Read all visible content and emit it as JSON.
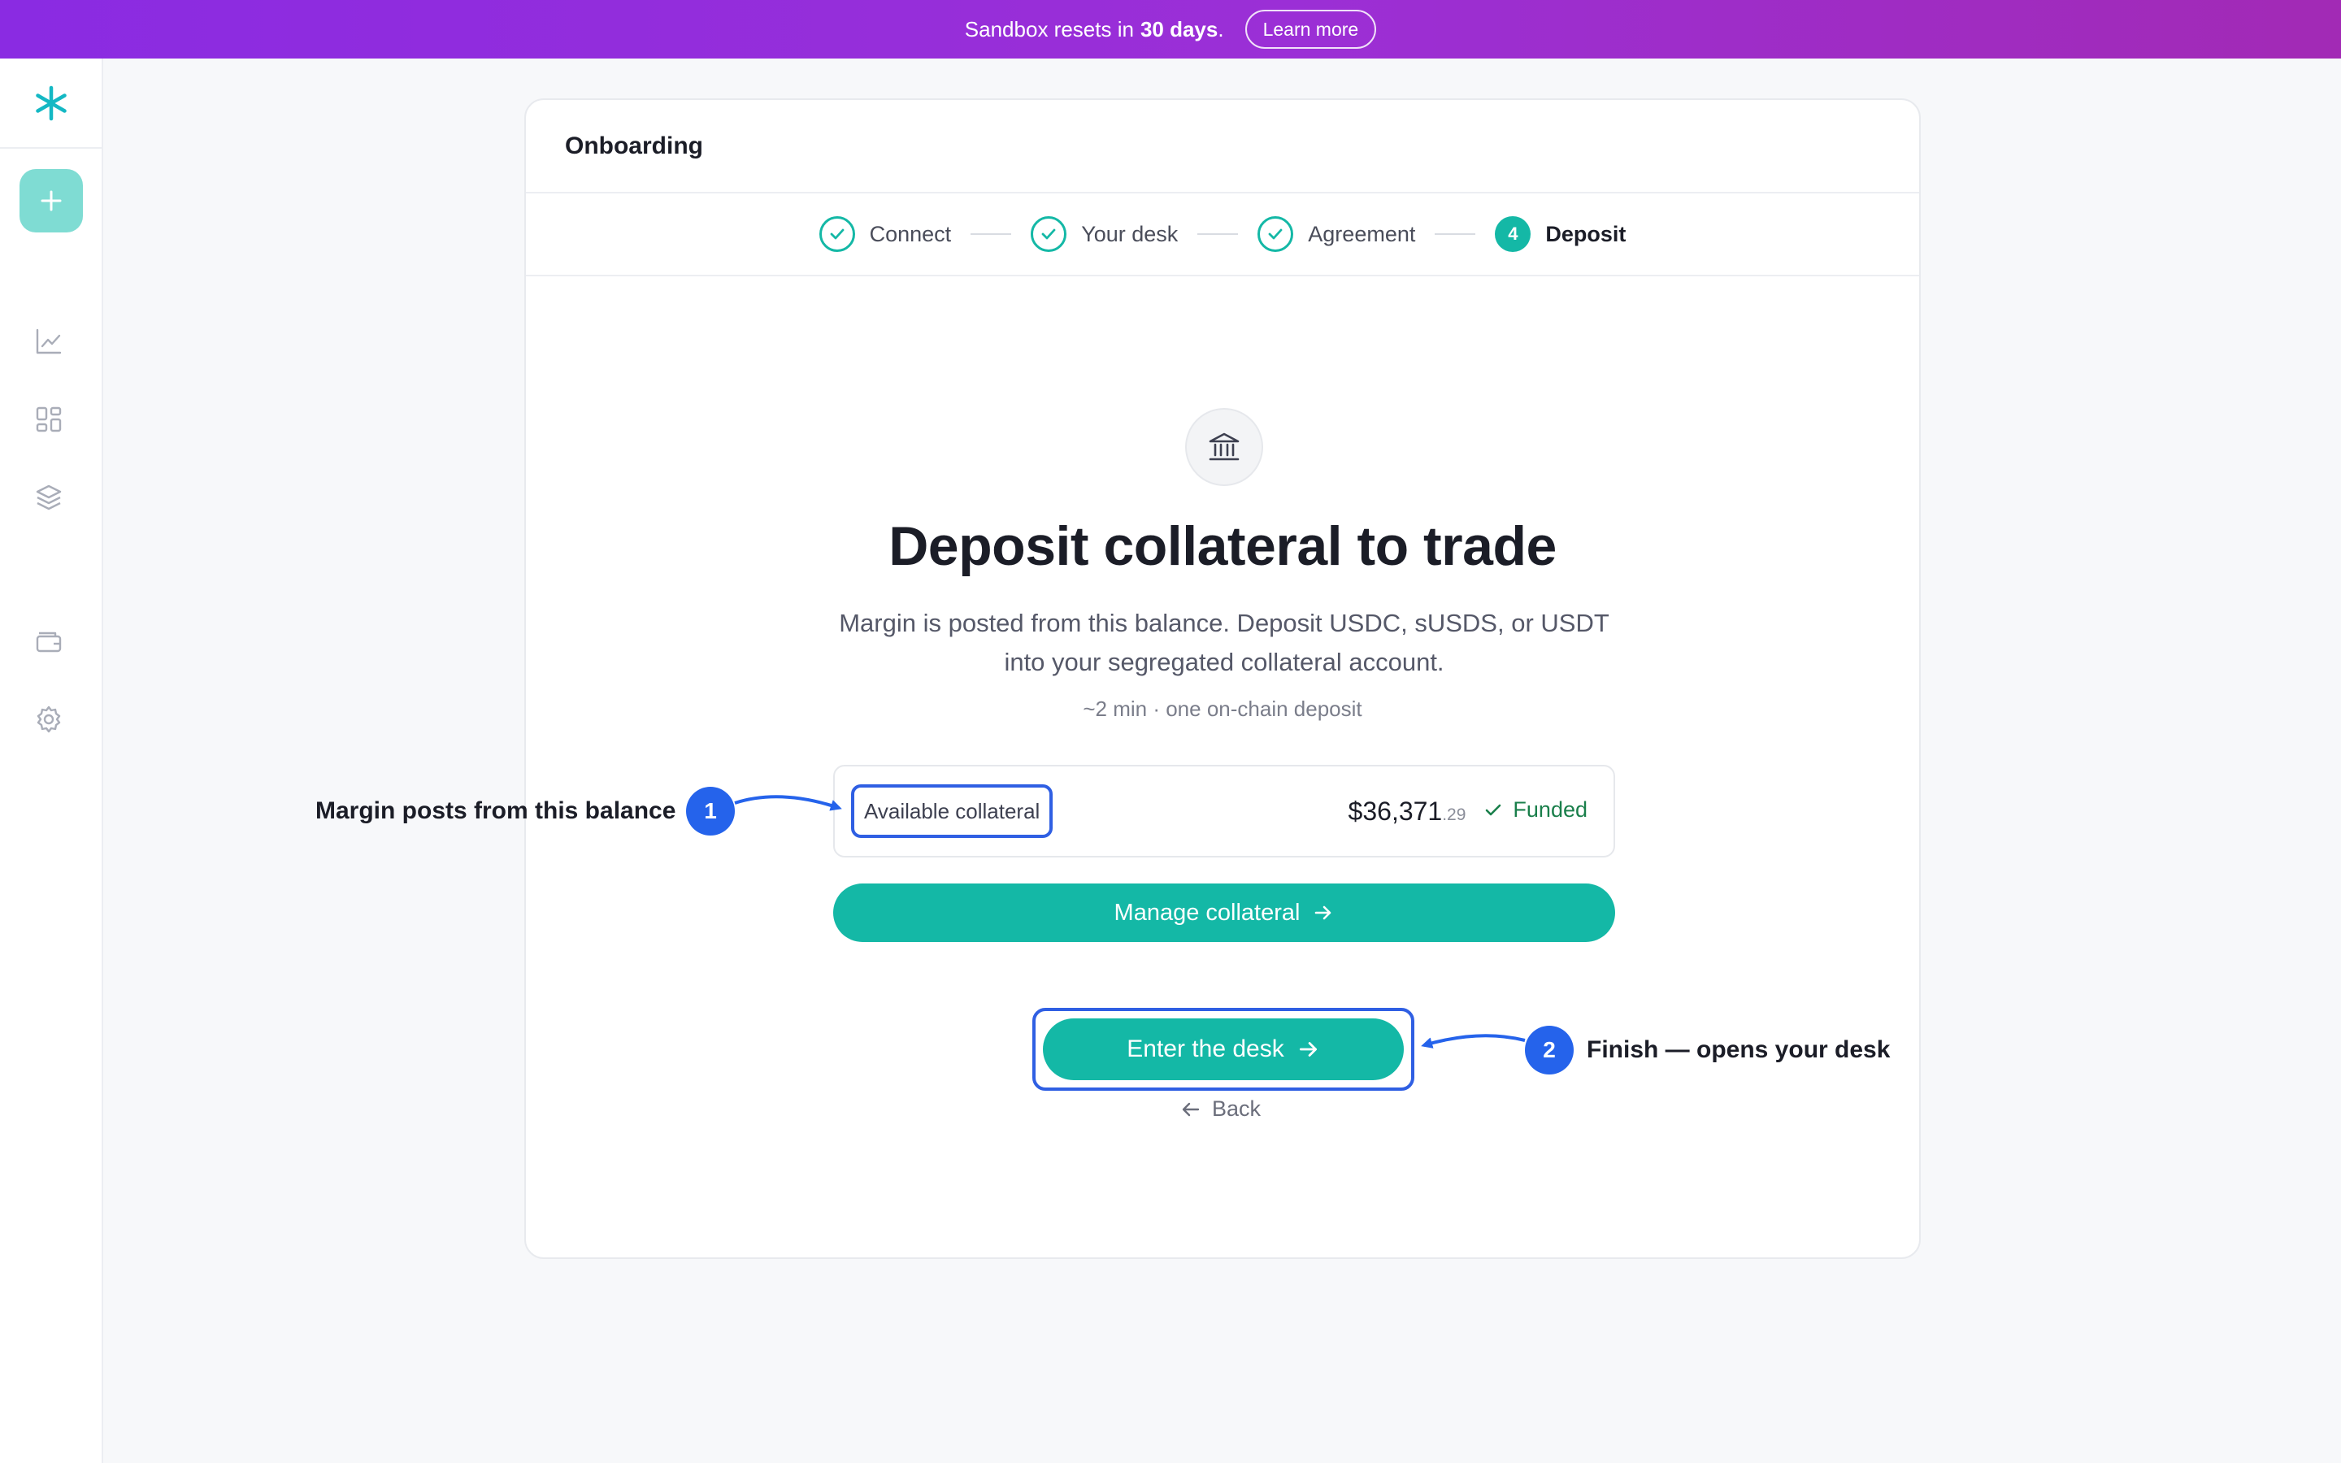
{
  "banner": {
    "prefix": "Sandbox resets in",
    "days": "30 days",
    "suffix": ".",
    "button": "Learn more"
  },
  "card": {
    "title": "Onboarding",
    "steps": [
      {
        "label": "Connect",
        "state": "done"
      },
      {
        "label": "Your desk",
        "state": "done"
      },
      {
        "label": "Agreement",
        "state": "done"
      },
      {
        "label": "Deposit",
        "number": "4",
        "state": "active"
      }
    ]
  },
  "hero": {
    "icon": "bank-icon",
    "title": "Deposit collateral to trade",
    "description": "Margin is posted from this balance. Deposit USDC, sUSDS, or USDT into your segregated collateral account.",
    "meta": "~2 min · one on-chain deposit"
  },
  "collateral": {
    "label": "Available collateral",
    "amount": "$36,371",
    "cents": ".29",
    "status": "Funded"
  },
  "buttons": {
    "manage": "Manage collateral",
    "enter": "Enter the desk",
    "back": "Back"
  },
  "annotations": [
    {
      "number": "1",
      "text": "Margin posts from this balance"
    },
    {
      "number": "2",
      "text": "Finish — opens your desk"
    }
  ],
  "colors": {
    "accent": "#14b8a6",
    "annotation": "#2563eb",
    "success": "#1a7f4b"
  }
}
